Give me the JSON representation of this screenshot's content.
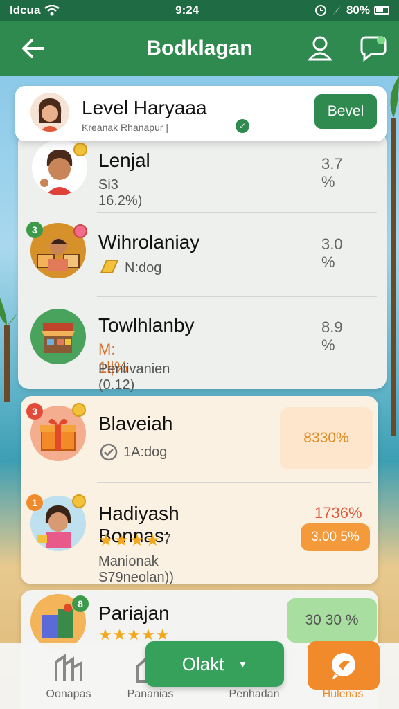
{
  "status_bar": {
    "carrier": "ldcua",
    "time": "9:24",
    "battery": "80%"
  },
  "app_bar": {
    "title": "Bodklagan"
  },
  "header": {
    "title": "Level Haryaaa",
    "subtitle": "Kreanak Rhanapur |",
    "button": "Bevel"
  },
  "rows": [
    {
      "name": "Lenjal",
      "meta": "Si3 16.2%)",
      "percent": "3.7 %"
    },
    {
      "name": "Wihrolaniay",
      "meta": "N:dog",
      "percent": "3.0 %",
      "badge": "3"
    },
    {
      "name": "Towlhlanby",
      "meta": "M: 1l|%",
      "meta2": "Penlivanien (0.12)",
      "percent": "8.9 %"
    },
    {
      "name": "Blaveiah",
      "meta": "1A:dog",
      "percent": "8330%",
      "badge": "3"
    },
    {
      "name": "Hadiyash Bonnas:",
      "stars_count": "7",
      "meta2": "Manionak S79neolan))",
      "percent": "1736%",
      "percent_button": "3.00 5%",
      "badge": "1"
    },
    {
      "name": "Pariajan",
      "percent": "30 30 %",
      "badge": "8"
    }
  ],
  "fab": {
    "label": "Olakt"
  },
  "nav": [
    {
      "label": "Oonapas",
      "icon": "building-icon"
    },
    {
      "label": "Pananias",
      "icon": "home-icon"
    },
    {
      "label": "Penhadan",
      "icon": "grid-icon"
    },
    {
      "label": "Hulenas",
      "icon": "chat-bubble-icon"
    }
  ],
  "colors": {
    "primary_green": "#2f8a4f",
    "accent_orange": "#f08a2a",
    "percent_orange": "#e08a1f",
    "light_green": "#a8dfa0"
  }
}
